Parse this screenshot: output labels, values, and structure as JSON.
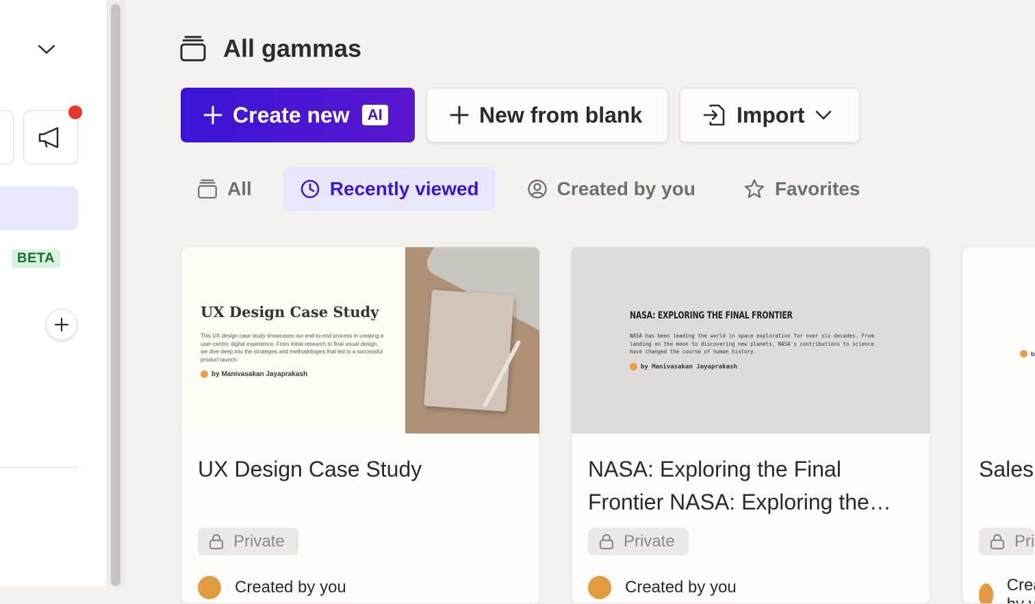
{
  "sidebar": {
    "beta_label": "BETA"
  },
  "header": {
    "title": "All gammas"
  },
  "actions": {
    "create_label": "Create new",
    "ai_badge": "AI",
    "blank_label": "New from blank",
    "import_label": "Import"
  },
  "tabs": [
    {
      "label": "All",
      "icon": "stack-icon"
    },
    {
      "label": "Recently viewed",
      "icon": "clock-icon"
    },
    {
      "label": "Created by you",
      "icon": "user-circle-icon"
    },
    {
      "label": "Favorites",
      "icon": "star-icon"
    }
  ],
  "cards": [
    {
      "name": "UX Design Case Study",
      "privacy": "Private",
      "meta": "Created by you",
      "thumb": {
        "title": "UX Design Case Study",
        "body": "This UX design case study showcases our end-to-end process in creating a user-centric digital experience. From initial research to final visual design, we dive deep into the strategies and methodologies that led to a successful product launch.",
        "by": "by Manivasakan Jayaprakash"
      }
    },
    {
      "name": "NASA: Exploring the Final Frontier NASA: Exploring the…",
      "privacy": "Private",
      "meta": "Created by you",
      "thumb": {
        "title": "NASA: EXPLORING THE FINAL FRONTIER",
        "body": "NASA has been leading the world in space exploration for over six decades. From landing on the moon to discovering new planets, NASA's contributions to science have changed the course of human history.",
        "by": "by Manivasakan Jayaprakash"
      }
    },
    {
      "name": "Sales",
      "privacy": "Pri",
      "meta": "Created by you",
      "thumb": {
        "by": "b"
      }
    }
  ],
  "colors": {
    "accent": "#3b16d6",
    "notification": "#e8362f",
    "beta_bg": "#d7f5dd"
  }
}
